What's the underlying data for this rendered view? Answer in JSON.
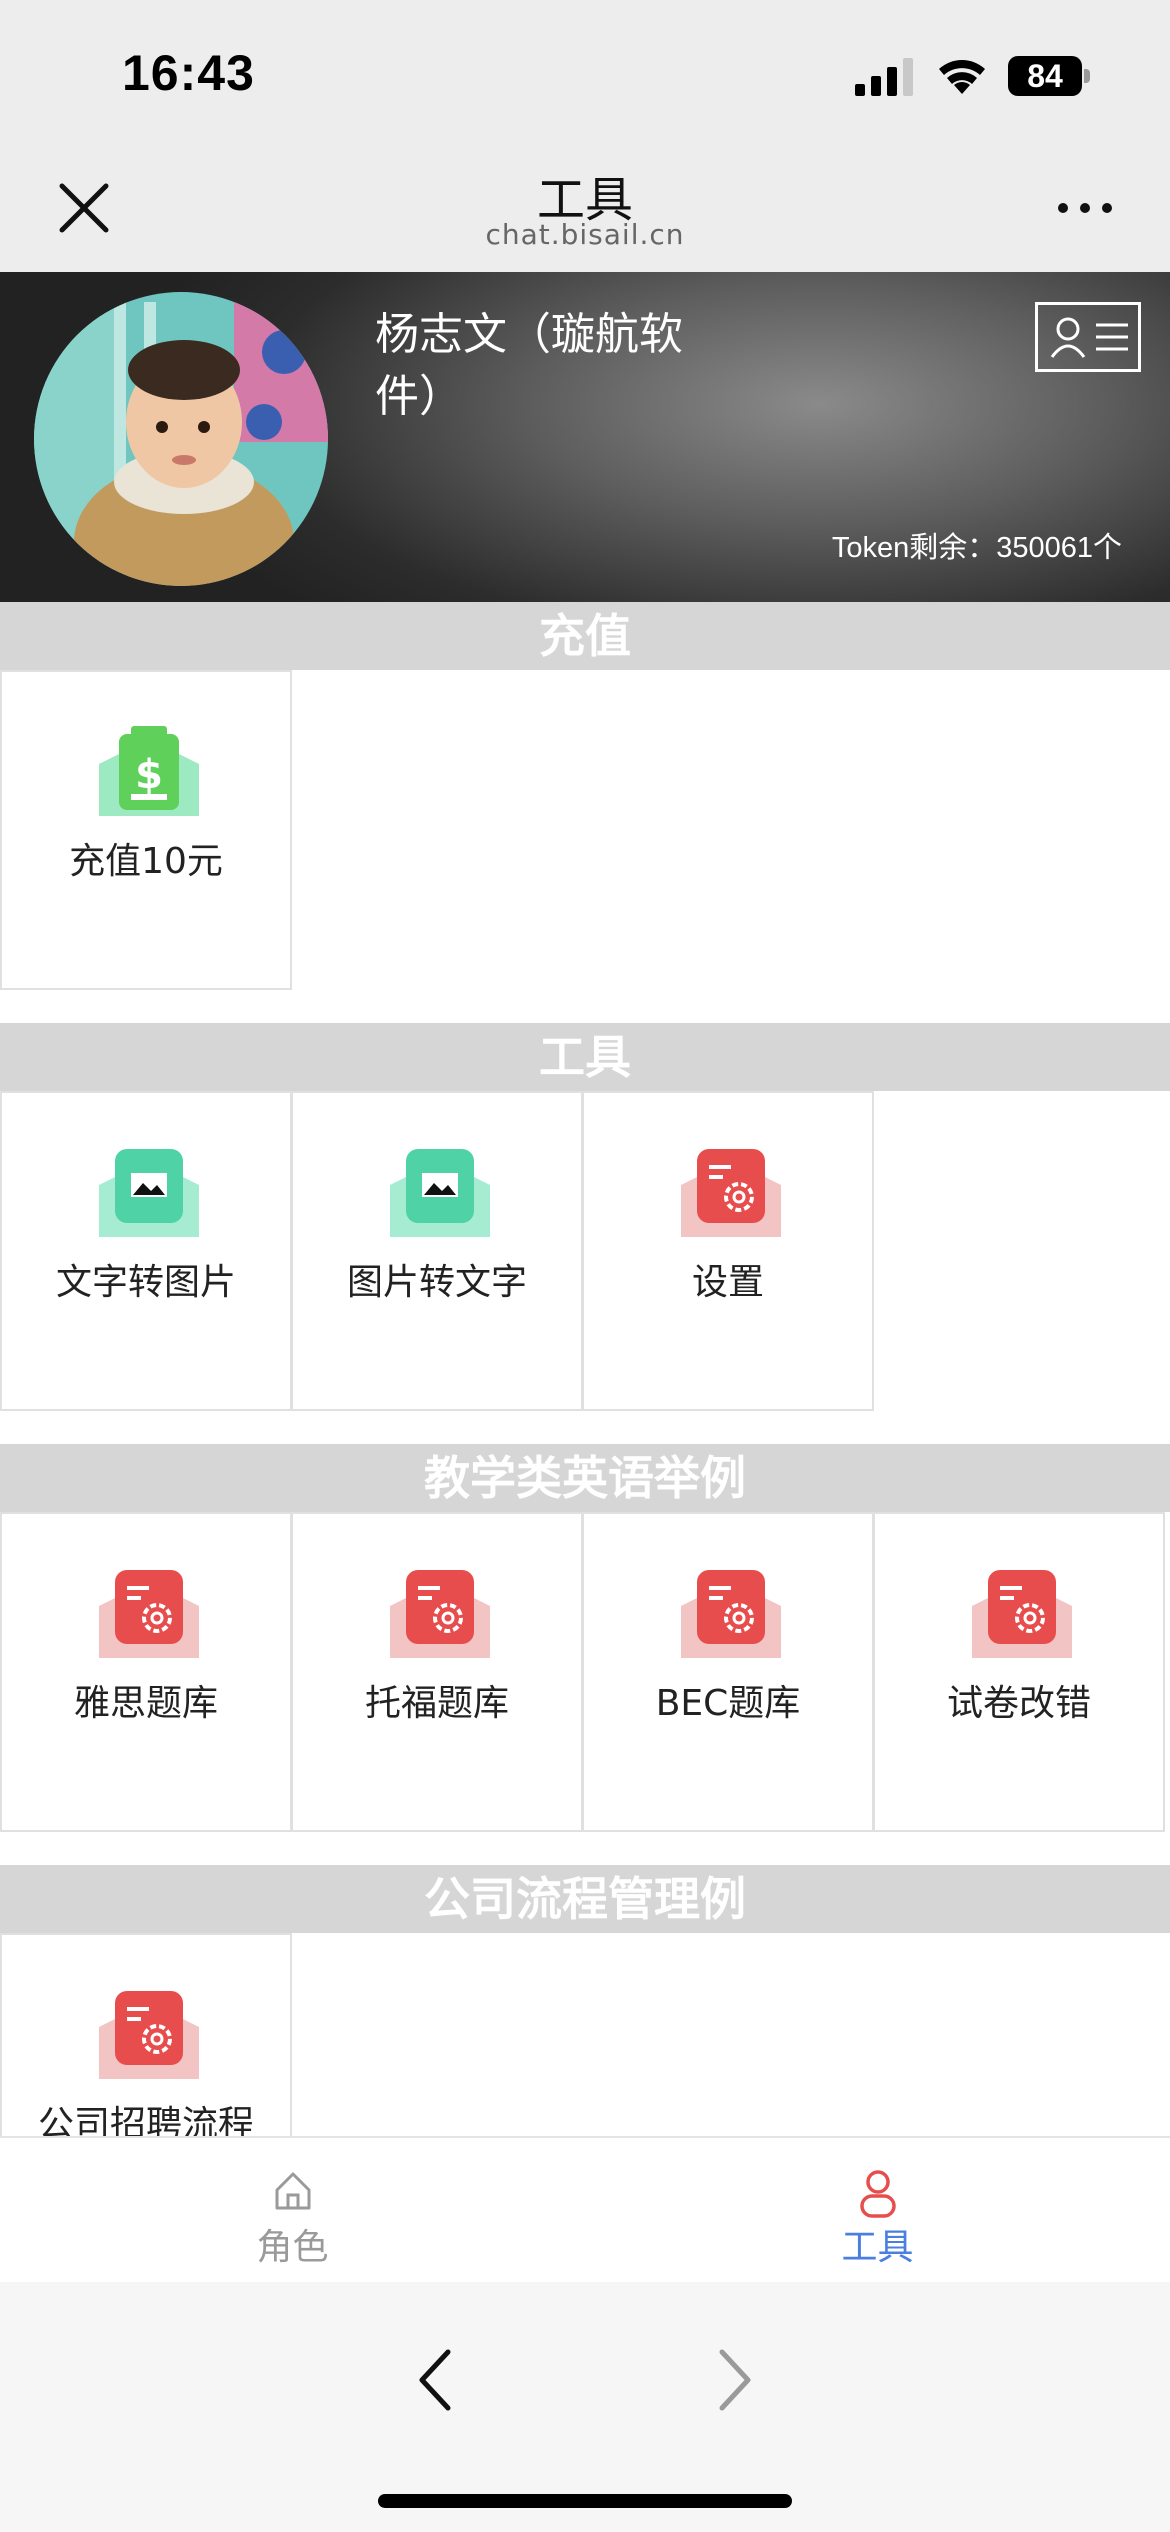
{
  "status": {
    "time": "16:43",
    "battery": "84"
  },
  "nav": {
    "title": "工具",
    "subtitle": "chat.bisail.cn"
  },
  "profile": {
    "name": "杨志文（璇航软件）",
    "token_label": "Token剩余：350061个"
  },
  "sections": {
    "recharge": {
      "title": "充值",
      "items": [
        {
          "label": "充值10元",
          "icon": "money-battery-icon"
        }
      ]
    },
    "tools": {
      "title": "工具",
      "items": [
        {
          "label": "文字转图片",
          "icon": "image-icon"
        },
        {
          "label": "图片转文字",
          "icon": "image-icon"
        },
        {
          "label": "设置",
          "icon": "settings-icon"
        }
      ]
    },
    "teaching": {
      "title": "教学类英语举例",
      "items": [
        {
          "label": "雅思题库",
          "icon": "settings-icon"
        },
        {
          "label": "托福题库",
          "icon": "settings-icon"
        },
        {
          "label": "BEC题库",
          "icon": "settings-icon"
        },
        {
          "label": "试卷改错",
          "icon": "settings-icon"
        }
      ]
    },
    "company": {
      "title": "公司流程管理例",
      "items": [
        {
          "label": "公司招聘流程",
          "icon": "settings-icon"
        }
      ]
    }
  },
  "tabs": [
    {
      "label": "角色",
      "icon": "home-icon",
      "active": false
    },
    {
      "label": "工具",
      "icon": "user-icon",
      "active": true
    }
  ],
  "colors": {
    "active_tab_label": "#4a7fe0",
    "active_tab_icon": "#e84d4d",
    "inactive_tab": "#9a9a9a",
    "section_header": "#d6d6d6",
    "icon_red": "#e84d4d",
    "icon_teal": "#4fd3a6",
    "icon_green": "#5fd05a"
  }
}
